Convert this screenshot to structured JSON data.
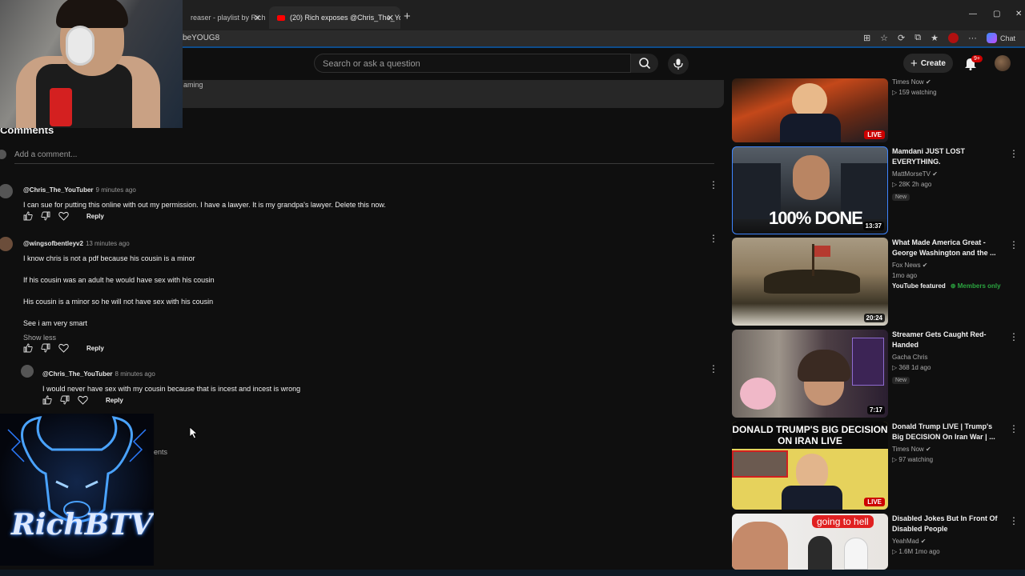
{
  "browser": {
    "tabs": [
      {
        "label": "reaser - playlist by Rich",
        "active": false
      },
      {
        "label": "(20) Rich exposes @Chris_The_You",
        "active": true
      }
    ],
    "url_fragment": "beYOUG8",
    "chat_label": "Chat"
  },
  "yt_header": {
    "search_placeholder": "Search or ask a question",
    "create_label": "Create",
    "notifications_badge": "9+"
  },
  "description": {
    "partial_text": "aming"
  },
  "comments": {
    "heading": "Comments",
    "add_placeholder": "Add a comment...",
    "items": [
      {
        "author": "@Chris_The_YouTuber",
        "time": "9 minutes ago",
        "lines": [
          "I can sue for putting this online with out my permission.  I have a lawyer.  It is my grandpa's lawyer.  Delete this now."
        ],
        "reply_label": "Reply"
      },
      {
        "author": "@wingsofbentleyv2",
        "time": "13 minutes ago",
        "lines": [
          "I know chris is not a pdf because his cousin is a minor",
          "If his cousin was an adult he would have sex with his cousin",
          "His cousin is a minor so he will not have sex with his cousin",
          "See i am very smart"
        ],
        "show_less": "Show less",
        "reply_label": "Reply"
      },
      {
        "author": "@Chris_The_YouTuber",
        "time": "8 minutes ago",
        "lines": [
          "I would never have sex with my cousin because that is incest and incest is wrong"
        ],
        "reply_label": "Reply"
      }
    ],
    "partial_text_behind_logo": "ents"
  },
  "overlay": {
    "logo_text": "RichBTV"
  },
  "sidebar": {
    "items": [
      {
        "title": "",
        "channel": "Times Now",
        "verified": true,
        "stats": "159 watching",
        "live": true,
        "badge": "LIVE",
        "thumb_caption": ""
      },
      {
        "title": "Mamdani JUST LOST EVERYTHING.",
        "channel": "MattMorseTV",
        "verified": true,
        "stats": "28K  2h ago",
        "tag": "New",
        "duration": "13:37",
        "thumb_caption": "100% DONE"
      },
      {
        "title": "What Made America Great - George Washington and the ...",
        "channel": "Fox News",
        "verified": true,
        "stats": "1mo ago",
        "featured": "YouTube featured",
        "members": "Members only",
        "duration": "20:24"
      },
      {
        "title": "Streamer Gets Caught Red-Handed",
        "channel": "Gacha Chris",
        "verified": false,
        "stats": "368  1d ago",
        "tag": "New",
        "duration": "7:17"
      },
      {
        "title": "Donald Trump LIVE | Trump's Big DECISION On Iran War | ...",
        "channel": "Times Now",
        "verified": true,
        "stats": "97 watching",
        "live": true,
        "badge": "LIVE",
        "thumb_caption": "DONALD TRUMP'S BIG DECISION ON IRAN LIVE"
      },
      {
        "title": "Disabled Jokes But In Front Of Disabled People",
        "channel": "YeahMad",
        "verified": true,
        "stats": "1.6M  1mo ago",
        "thumb_caption": "going to hell"
      }
    ]
  },
  "colors": {
    "accent_red": "#cc0000",
    "bg": "#0f0f0f",
    "members_green": "#2ba640"
  }
}
